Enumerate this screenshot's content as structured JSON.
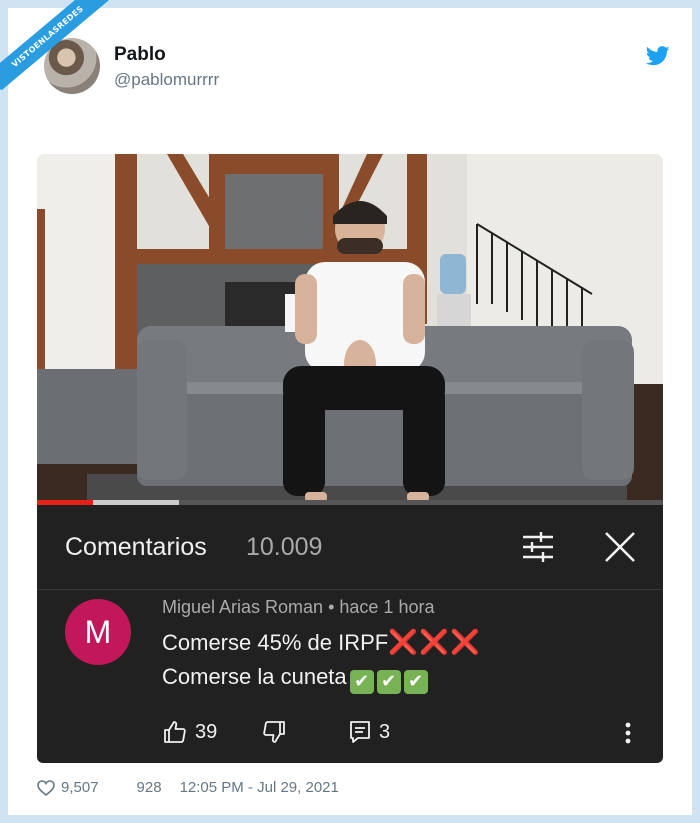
{
  "watermark": {
    "text": "VISTOENLASREDES",
    "sub": ".com"
  },
  "tweet": {
    "author_name": "Pablo",
    "author_handle": "@pablomurrrr",
    "footer": {
      "likes": "9,507",
      "retweets": "928",
      "timestamp": "12:05 PM - Jul 29, 2021"
    }
  },
  "youtube": {
    "progress_played_pct": 9,
    "comments_panel": {
      "title": "Comentarios",
      "count": "10.009",
      "comment": {
        "avatar_letter": "M",
        "author": "Miguel Arias Roman",
        "time": "• hace 1 hora",
        "line1": "Comerse 45% de IRPF",
        "line1_emoji": "❌❌❌",
        "line2": "Comerse la cuneta",
        "line2_emoji": "✔",
        "likes": "39",
        "replies": "3"
      }
    }
  },
  "colors": {
    "twitter_blue": "#1da1f2",
    "yt_red": "#e62117",
    "panel_bg": "#212121",
    "avatar_m": "#c2185b"
  }
}
